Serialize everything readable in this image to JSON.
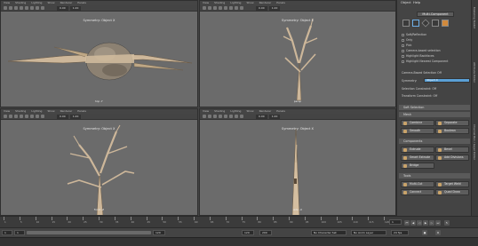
{
  "app": {
    "menu": [
      "View",
      "Shading",
      "Lighting",
      "Show",
      "Renderer",
      "Panels"
    ]
  },
  "viewports": [
    {
      "title": "Symmetry: Object X",
      "camera": "top -Y",
      "view": "front-view",
      "field": "0.00",
      "fval": "1.00"
    },
    {
      "title": "Symmetry: Object X",
      "camera": "persp",
      "view": "persp-view",
      "field": "0.00",
      "fval": "1.00"
    },
    {
      "title": "Symmetry: Object X",
      "camera": "front -Z",
      "view": "front-view",
      "field": "0.00",
      "fval": "1.00"
    },
    {
      "title": "Symmetry: Object X",
      "camera": "side -X",
      "view": "side-view",
      "field": "0.00",
      "fval": "1.00"
    }
  ],
  "panel": {
    "tabs": [
      "Object",
      "Help"
    ],
    "mode_button": "Multi-Component",
    "options": {
      "soft_select": "Soft/Reflection",
      "only": "Only",
      "pick_walk": "Pick",
      "backfaces": "Camera-based selection",
      "highlight_backfaces": "Highlight Backfaces",
      "highlight_nearest": "Highlight Nearest Component"
    },
    "camera_based": "Camera-Based Selection",
    "camera_based_state": "Off",
    "symmetry_label": "Symmetry:",
    "symmetry_value": "Object X",
    "selection_constraint_label": "Selection Constraint:",
    "selection_constraint_state": "Off",
    "transform_constraint_label": "Transform Constraint:",
    "transform_constraint_state": "Off",
    "soft_selection": "Soft Selection",
    "sections": {
      "mesh": "Mesh",
      "components": "Components",
      "tools": "Tools"
    },
    "mesh_buttons": [
      "Combine",
      "Separate",
      "Smooth",
      "Boolean"
    ],
    "component_buttons": [
      "Extrude",
      "Bevel",
      "Smart Extrude",
      "Add Divisions",
      "Bridge"
    ],
    "tool_buttons": [
      "Multi-Cut",
      "Target Weld",
      "Connect",
      "Quad Draw"
    ],
    "strip_labels": [
      "Modeling Toolkit",
      "Attribute Editor",
      "Channel Box / Layer Editor"
    ]
  },
  "timeline": {
    "ticks": [
      "1",
      "5",
      "10",
      "15",
      "20",
      "25",
      "30",
      "35",
      "40",
      "45",
      "50",
      "55",
      "60",
      "65",
      "70",
      "75",
      "80",
      "85",
      "90",
      "95",
      "100",
      "105",
      "110",
      "115",
      "120"
    ],
    "current_frame": "1"
  },
  "range": {
    "start": "1",
    "start_inner": "1",
    "end_inner": "120",
    "end": "120",
    "end2": "200",
    "character_set": "No Character Set",
    "anim_layer": "No Anim Layer",
    "fps": "24 fps"
  },
  "status": {
    "text": ""
  }
}
